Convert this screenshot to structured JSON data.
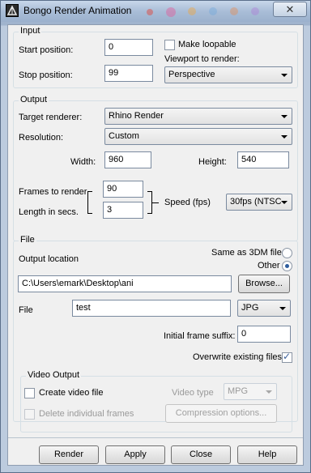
{
  "window": {
    "title": "Bongo Render Animation",
    "close_glyph": "✕"
  },
  "input": {
    "group_label": "Input",
    "start_label": "Start position:",
    "start_value": "0",
    "stop_label": "Stop position:",
    "stop_value": "99",
    "make_loopable_label": "Make loopable",
    "make_loopable_checked": false,
    "viewport_label": "Viewport to render:",
    "viewport_value": "Perspective"
  },
  "output": {
    "group_label": "Output",
    "target_renderer_label": "Target renderer:",
    "target_renderer_value": "Rhino Render",
    "resolution_label": "Resolution:",
    "resolution_value": "Custom",
    "width_label": "Width:",
    "width_value": "960",
    "height_label": "Height:",
    "height_value": "540",
    "frames_label": "Frames to render",
    "frames_value": "90",
    "length_label": "Length in secs.",
    "length_value": "3",
    "speed_label": "Speed (fps)",
    "speed_value": "30fps (NTSC"
  },
  "file": {
    "group_label": "File",
    "output_location_label": "Output location",
    "same_as_3dm_label": "Same as 3DM file",
    "other_label": "Other",
    "selected_location": "Other",
    "path_value": "C:\\Users\\emark\\Desktop\\ani",
    "browse_label": "Browse...",
    "file_label": "File",
    "file_value": "test",
    "format_value": "JPG",
    "suffix_label": "Initial frame suffix:",
    "suffix_value": "0",
    "overwrite_label": "Overwrite existing files",
    "overwrite_checked": true
  },
  "video": {
    "group_label": "Video Output",
    "create_label": "Create video file",
    "create_checked": false,
    "delete_label": "Delete individual frames",
    "delete_checked": false,
    "type_label": "Video type",
    "type_value": "MPG",
    "compression_label": "Compression options..."
  },
  "buttons": {
    "render": "Render",
    "apply": "Apply",
    "close": "Close",
    "help": "Help"
  },
  "icons": {
    "check": "✓"
  }
}
